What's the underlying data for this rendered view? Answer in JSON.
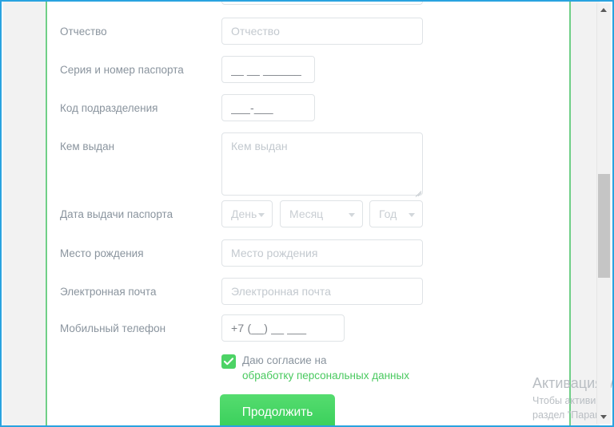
{
  "form": {
    "fields": [
      {
        "label": "Отчество",
        "placeholder": "Отчество",
        "type": "text"
      },
      {
        "label": "Серия и номер паспорта",
        "value": "__ __ ______",
        "type": "mask"
      },
      {
        "label": "Код подразделения",
        "value": "___-___",
        "type": "mask"
      },
      {
        "label": "Кем выдан",
        "placeholder": "Кем выдан",
        "type": "textarea"
      },
      {
        "label": "Дата выдачи паспорта",
        "type": "date-selects"
      },
      {
        "label": "Место рождения",
        "placeholder": "Место рождения",
        "type": "text"
      },
      {
        "label": "Электронная почта",
        "placeholder": "Электронная почта",
        "type": "text"
      },
      {
        "label": "Мобильный телефон",
        "value": "+7 (__) __ ___",
        "type": "mask"
      }
    ],
    "date_selects": {
      "day": "День",
      "month": "Месяц",
      "year": "Год"
    },
    "consent": {
      "checked": true,
      "text": "Даю согласие на",
      "link_text": "обработку персональных данных"
    },
    "submit_label": "Продолжить"
  },
  "watermark": {
    "title": "Активация W",
    "line1": "Чтобы активиро",
    "line2": "раздел \"Параме"
  },
  "colors": {
    "accent_green": "#49c95f",
    "button_green": "#38cf5a",
    "rule_green": "#6fcf87",
    "focus_blue": "#29a3e0",
    "label_gray": "#8a949e",
    "placeholder_gray": "#c3c9cf"
  },
  "scrollbar": {
    "up_icon": "triangle-up-icon",
    "down_icon": "triangle-down-icon"
  }
}
